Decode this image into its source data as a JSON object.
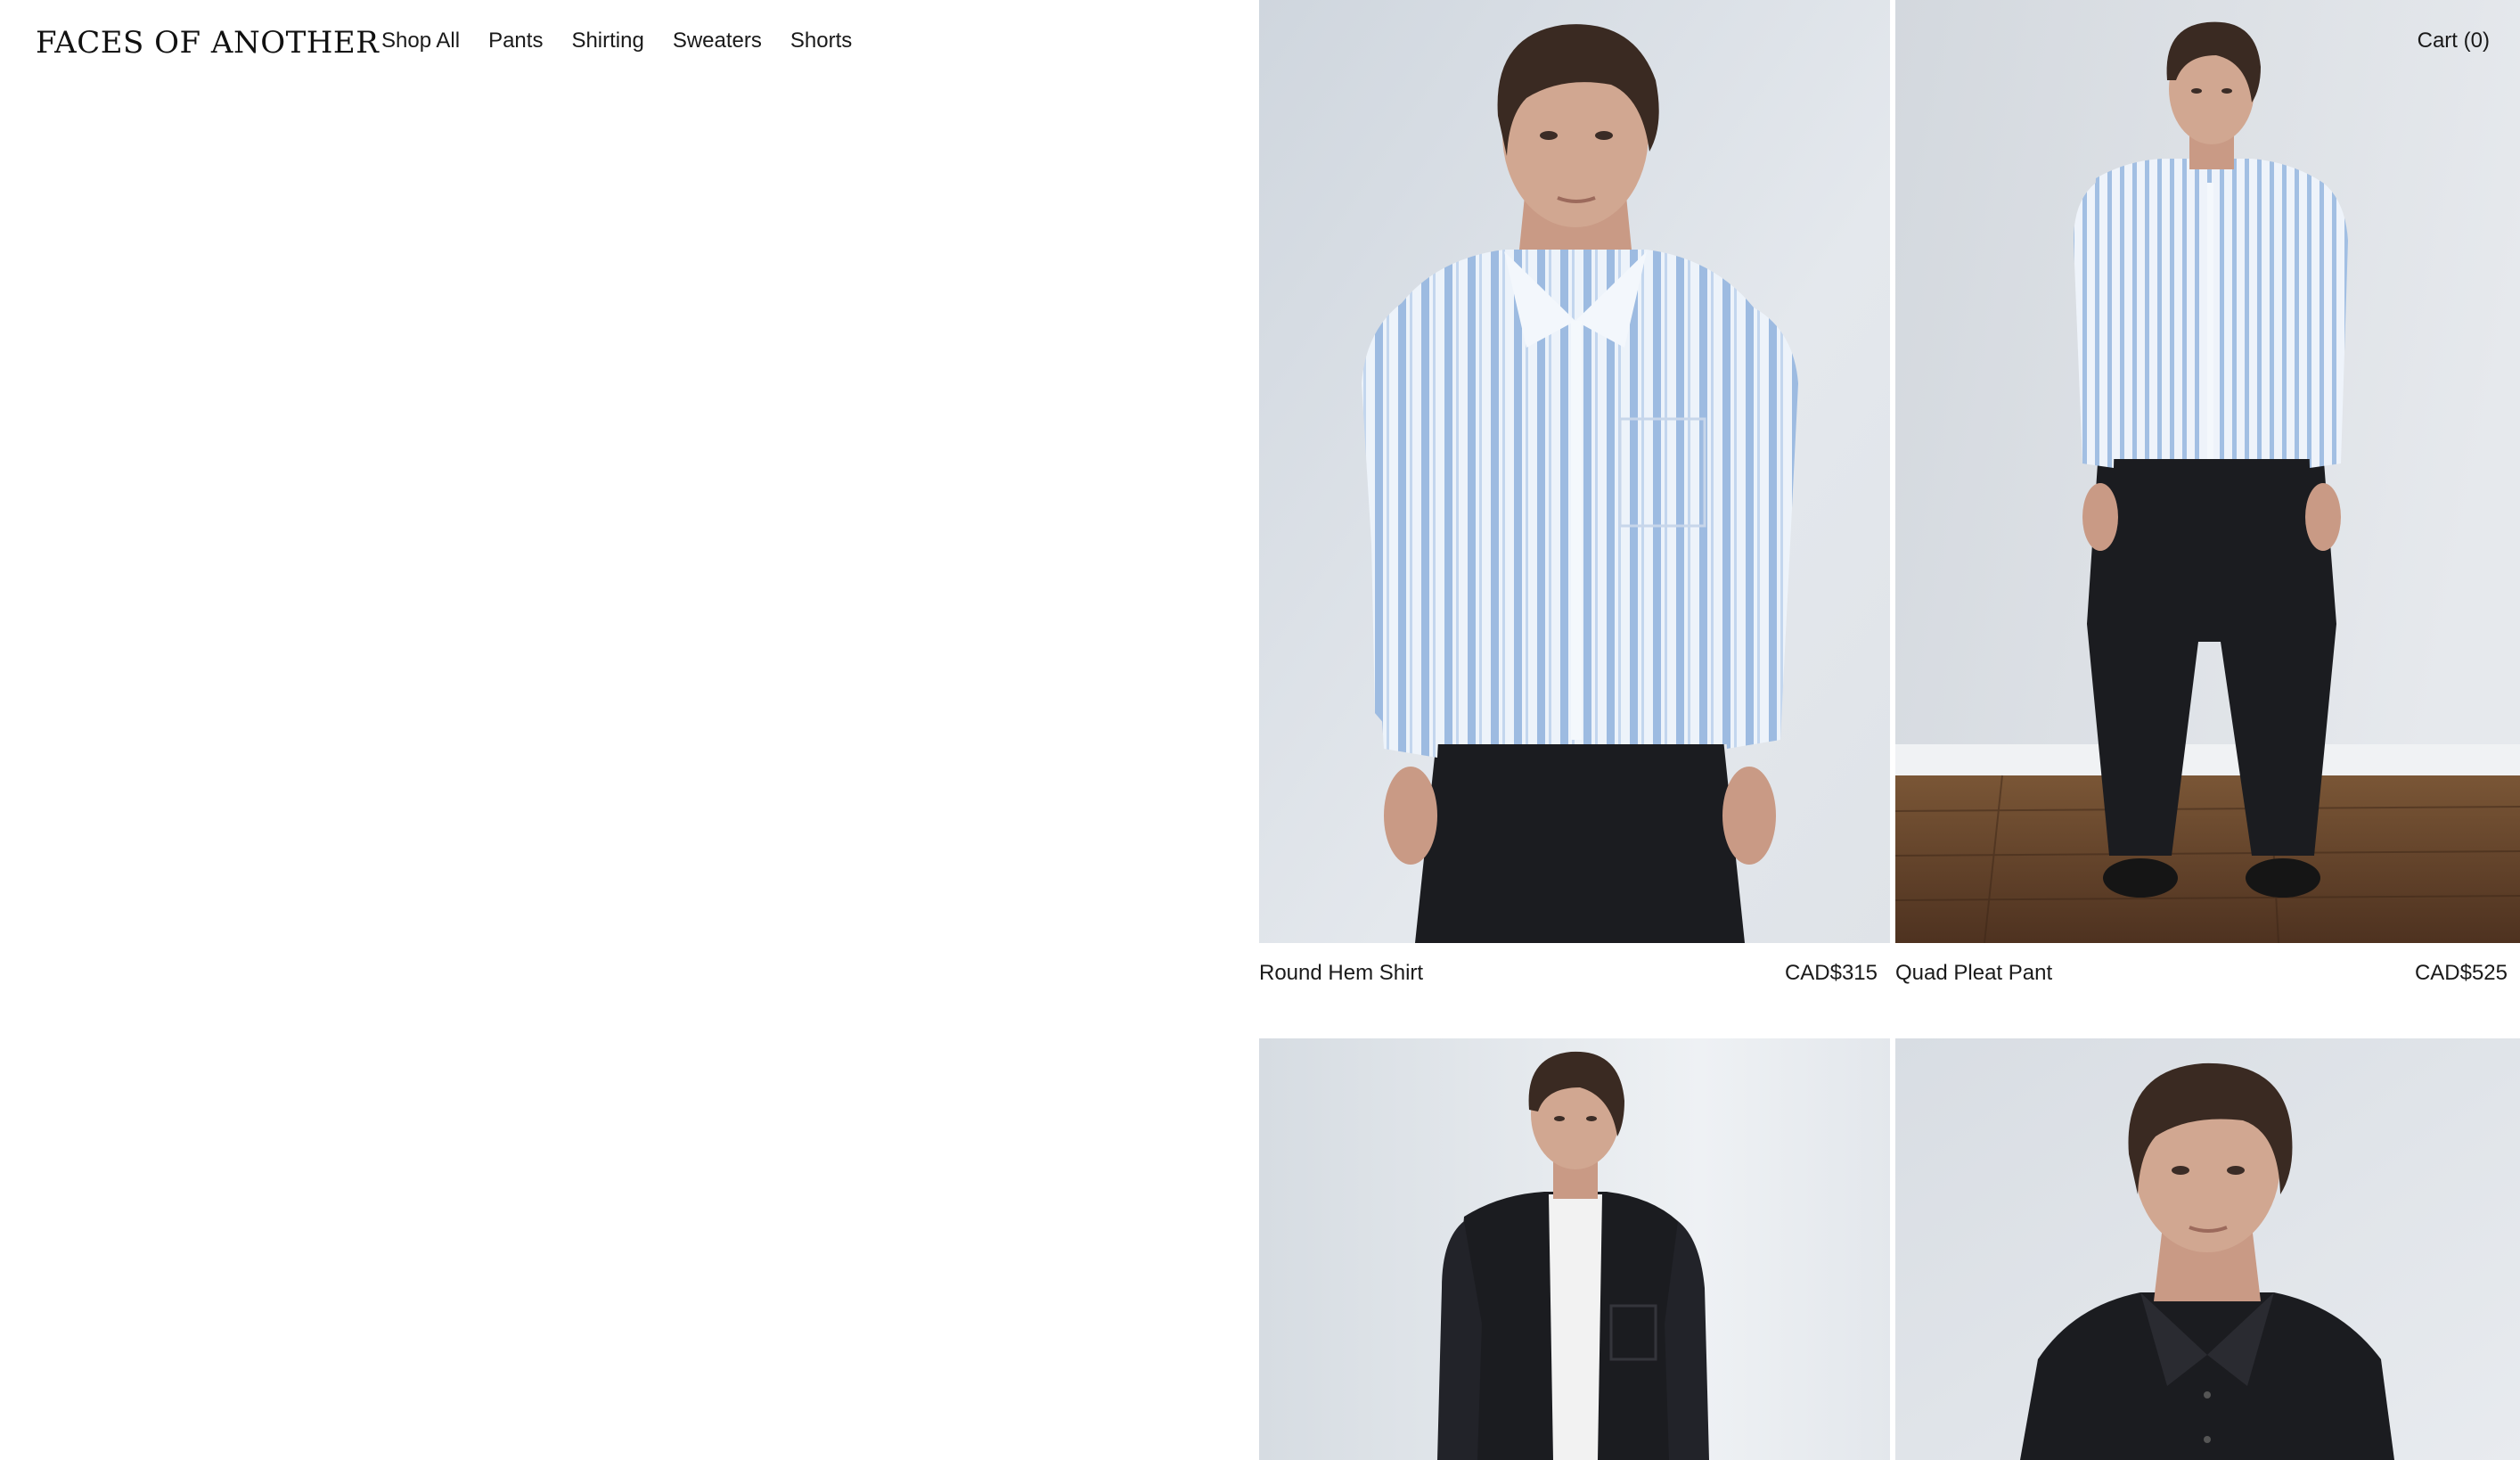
{
  "header": {
    "logo": "FACES OF ANOTHER",
    "nav": [
      "Shop All",
      "Pants",
      "Shirting",
      "Sweaters",
      "Shorts"
    ],
    "cart_label": "Cart",
    "cart_count": "0"
  },
  "products": [
    {
      "name": "Round Hem Shirt",
      "price": "CAD$315",
      "image": "model-blue-striped-shirt-closeup"
    },
    {
      "name": "Quad Pleat Pant",
      "price": "CAD$525",
      "image": "model-full-length-black-pleated-pant"
    },
    {
      "name": "",
      "price": "",
      "image": "model-black-overshirt-white-tee"
    },
    {
      "name": "",
      "price": "",
      "image": "model-black-shirt-portrait"
    }
  ],
  "colors": {
    "backdrop": "#dde2e8",
    "shirt_blue": "#a9c3e4",
    "black_garment": "#1b1c20",
    "floor": "#6b4a31",
    "skin": "#d1a791",
    "hair": "#3a2a22"
  }
}
